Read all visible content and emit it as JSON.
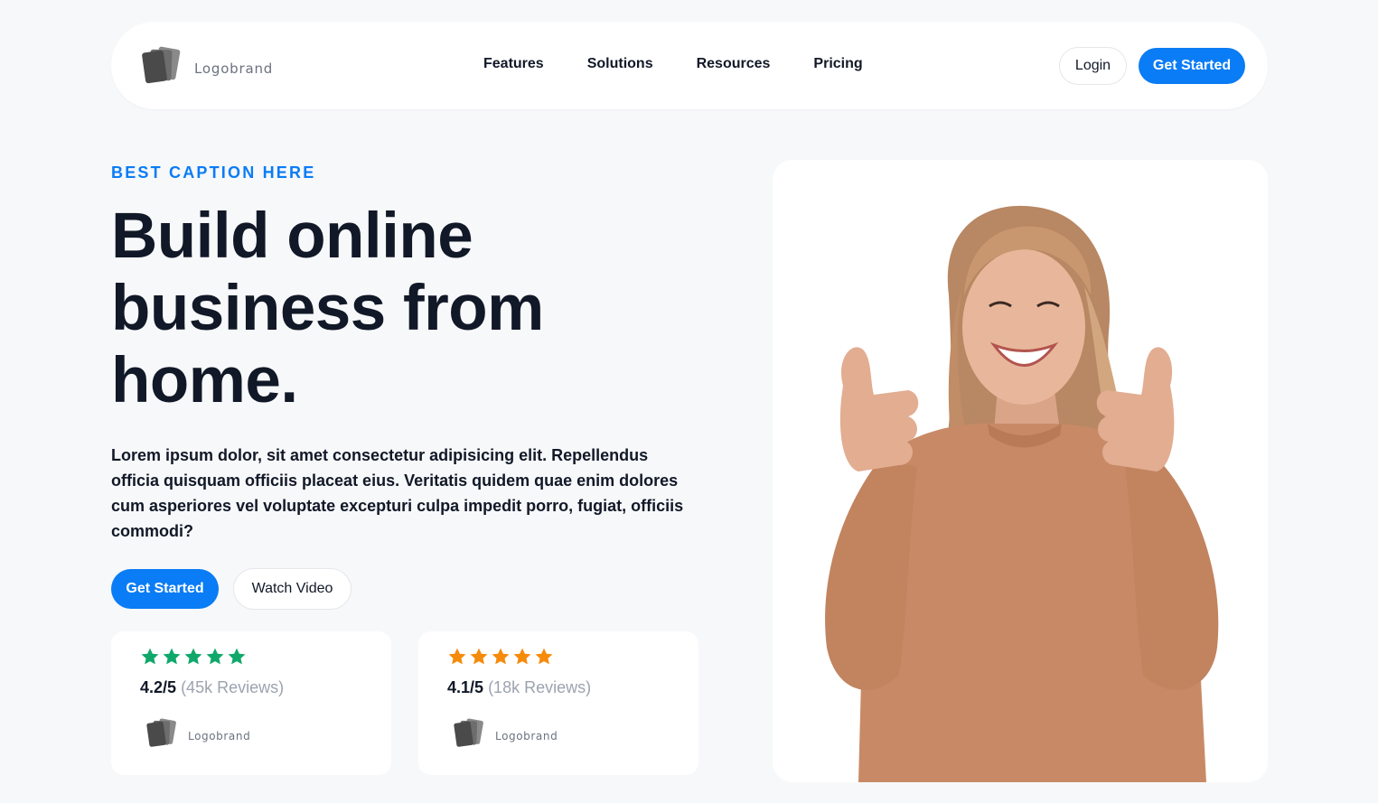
{
  "navbar": {
    "brand": "Logobrand",
    "links": [
      "Features",
      "Solutions",
      "Resources",
      "Pricing"
    ],
    "login_label": "Login",
    "cta_label": "Get Started"
  },
  "hero": {
    "caption": "BEST CAPTION HERE",
    "headline": "Build online business from home.",
    "description": "Lorem ipsum dolor, sit amet consectetur adipisicing elit. Repellendus officia quisquam officiis placeat eius. Veritatis quidem quae enim dolores cum asperiores vel voluptate excepturi culpa impedit porro, fugiat, officiis commodi?",
    "cta_label": "Get Started",
    "watch_label": "Watch Video"
  },
  "reviews": [
    {
      "stars": 5,
      "star_color": "#10a86a",
      "rating": "4.2/5",
      "count": "(45k Reviews)",
      "brand": "Logobrand"
    },
    {
      "stars": 5,
      "star_color": "#f58a0b",
      "rating": "4.1/5",
      "count": "(18k Reviews)",
      "brand": "Logobrand"
    }
  ],
  "colors": {
    "accent": "#0a7cf5",
    "text": "#111827",
    "muted": "#9ca3af",
    "background": "#f7f8fa"
  }
}
